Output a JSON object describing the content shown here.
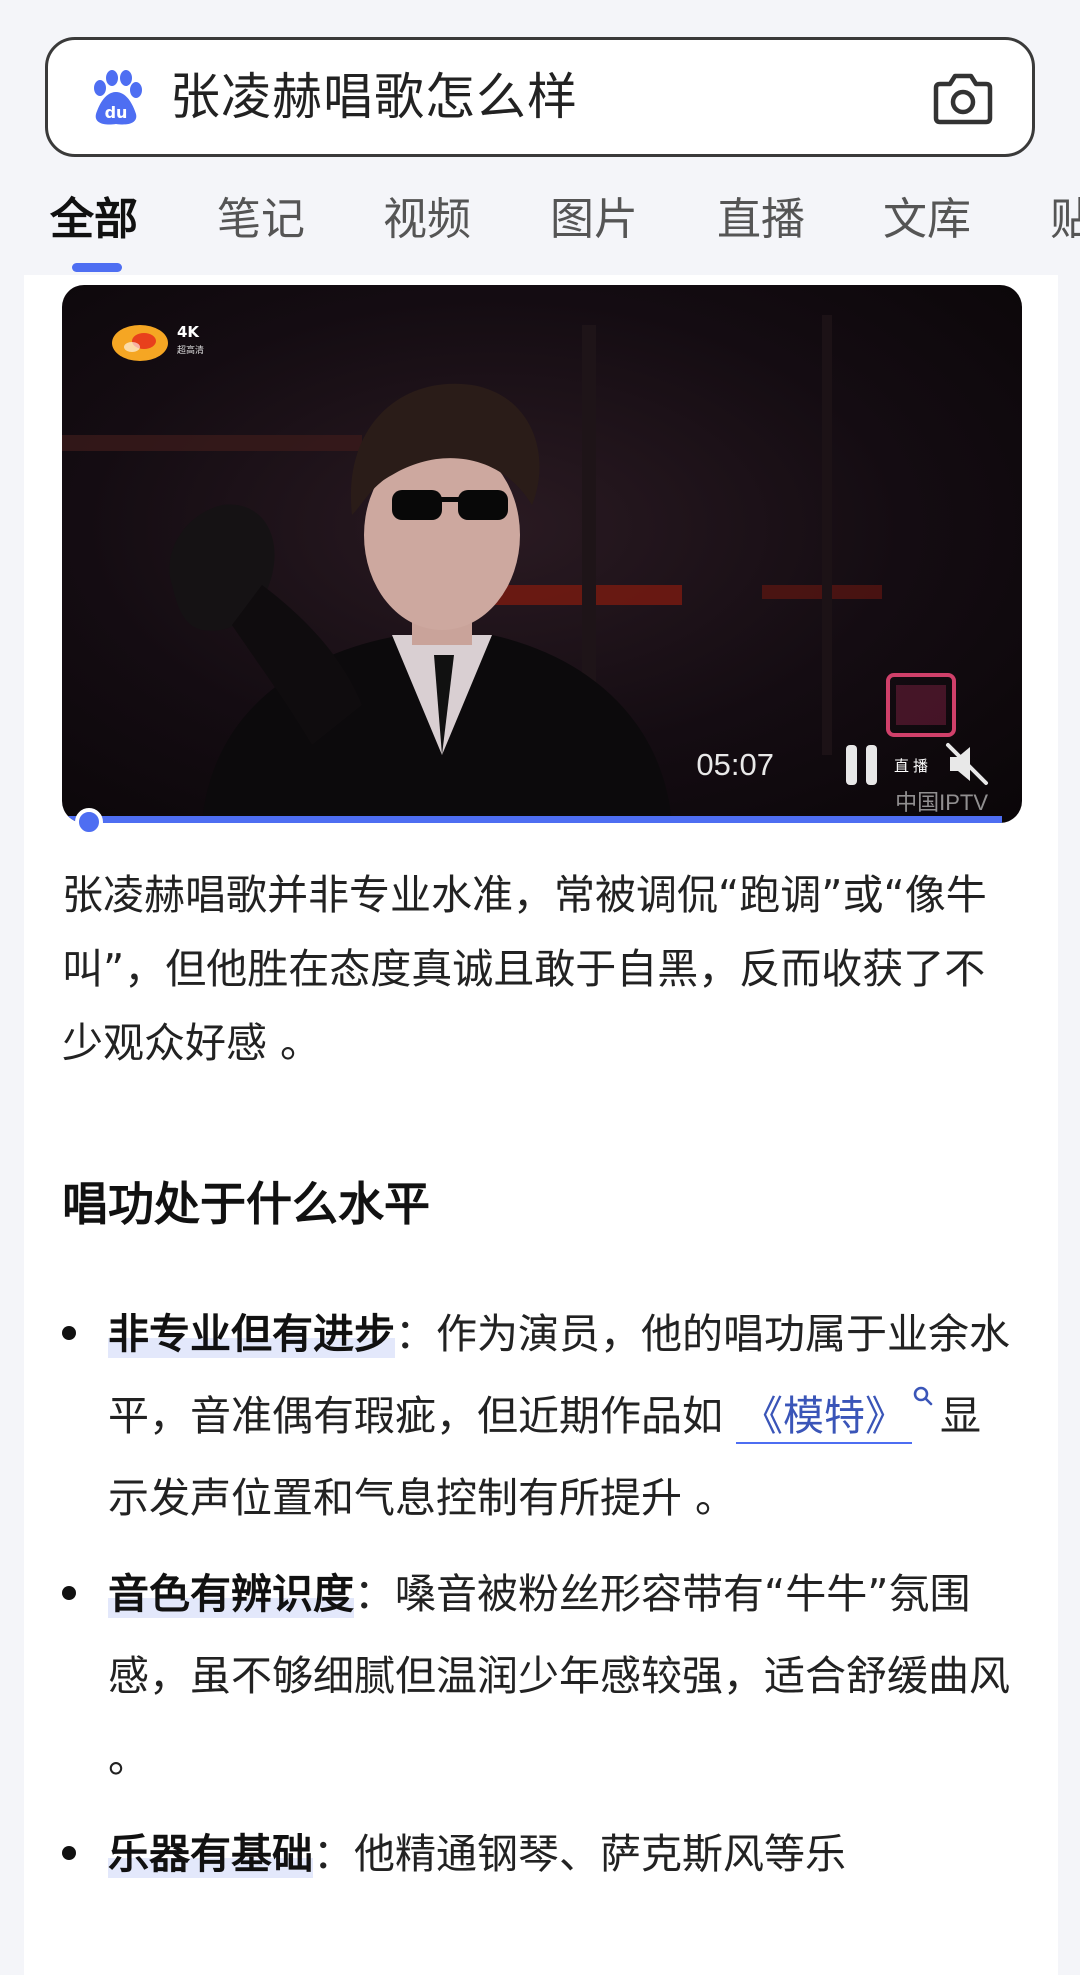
{
  "search": {
    "query": "张凌赫唱歌怎么样",
    "logo_icon": "baidu-paw-icon",
    "camera_icon": "camera-icon"
  },
  "tabs": [
    {
      "label": "全部",
      "active": true
    },
    {
      "label": "笔记",
      "active": false
    },
    {
      "label": "视频",
      "active": false
    },
    {
      "label": "图片",
      "active": false
    },
    {
      "label": "直播",
      "active": false
    },
    {
      "label": "文库",
      "active": false
    },
    {
      "label": "贴",
      "active": false
    }
  ],
  "video": {
    "duration": "05:07",
    "channel_badge": "4K",
    "channel_badge_sub": "超高清",
    "live_label": "直播",
    "watermark": "中国IPTV",
    "progress": 0.0
  },
  "answer": {
    "summary": "张凌赫唱歌并非专业水准，常被调侃“跑调”或“像牛叫”，但他胜在态度真诚且敢于自黑，反而收获了不少观众好感 。",
    "section_title": "唱功处于什么水平",
    "bullets": [
      {
        "head": "非专业但有进步",
        "text_before": "：作为演员，他的唱功属于业余水平，音准偶有瑕疵，但近期作品如",
        "link": "《模特》",
        "text_after": "显示发声位置和气息控制有所提升 。"
      },
      {
        "head": "音色有辨识度",
        "text_before": "：嗓音被粉丝形容带有“牛牛”氛围感，虽不够细腻但温润少年感较强，适合舒缓曲风 。"
      },
      {
        "head": "乐器有基础",
        "text_before": "：他精通钢琴、萨克斯风等乐"
      }
    ]
  },
  "colors": {
    "accent": "#4e6ef2",
    "link": "#3a55b8",
    "background": "#f4f5f9"
  }
}
